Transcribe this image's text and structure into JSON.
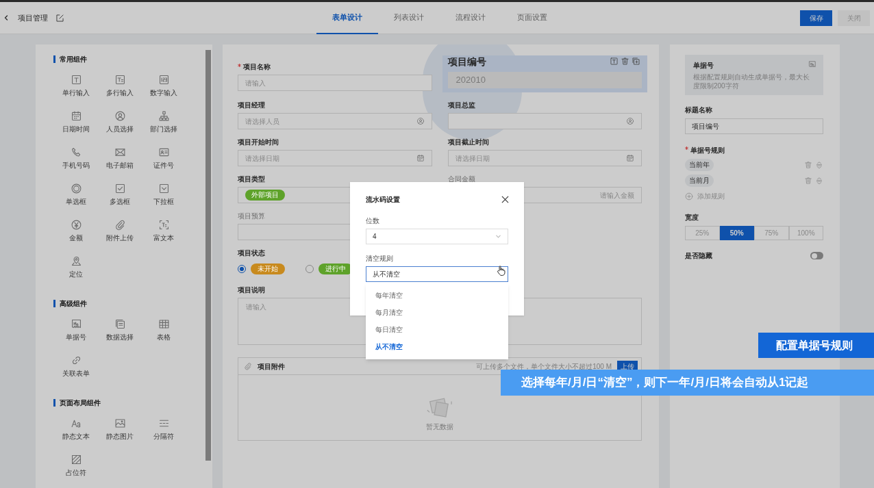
{
  "header": {
    "title": "项目管理",
    "tabs": [
      {
        "label": "表单设计",
        "selected": true
      },
      {
        "label": "列表设计",
        "selected": false
      },
      {
        "label": "流程设计",
        "selected": false
      },
      {
        "label": "页面设置",
        "selected": false
      }
    ],
    "buttons": [
      {
        "label": "保存",
        "kind": "primary"
      },
      {
        "label": "关闭",
        "kind": "disabled"
      }
    ]
  },
  "component_groups": [
    {
      "title": "常用组件",
      "items": [
        "单行输入",
        "多行输入",
        "数字输入",
        "日期时间",
        "人员选择",
        "部门选择",
        "手机号码",
        "电子邮箱",
        "证件号",
        "单选框",
        "多选框",
        "下拉框",
        "金额",
        "附件上传",
        "富文本",
        "定位"
      ]
    },
    {
      "title": "高级组件",
      "items": [
        "单据号",
        "数据选择",
        "表格",
        "关联表单"
      ]
    },
    {
      "title": "页面布局组件",
      "items": [
        "静态文本",
        "静态图片",
        "分隔符",
        "占位符"
      ]
    }
  ],
  "form": {
    "fields": [
      {
        "kind": "text",
        "label": "项目名称",
        "required": true,
        "placeholder": "请输入"
      },
      {
        "kind": "serial",
        "label": "项目编号",
        "value": "202010",
        "selected": true
      },
      {
        "kind": "person",
        "label": "项目经理",
        "placeholder": "请选择人员"
      },
      {
        "kind": "person",
        "label": "项目总监"
      },
      {
        "kind": "date",
        "label": "项目开始时间",
        "placeholder": "请选择日期"
      },
      {
        "kind": "date",
        "label": "项目截止时间",
        "placeholder": "请选择日期"
      },
      {
        "kind": "tags",
        "label": "项目类型",
        "tags": [
          {
            "text": "外部项目",
            "color": "#5ea22a"
          }
        ]
      },
      {
        "kind": "amount",
        "label": "合同金额",
        "disabled": true,
        "placeholder": "请输入金额"
      },
      {
        "kind": "text",
        "label": "项目预算",
        "disabled": true
      },
      {
        "kind": "radio",
        "label": "项目状态",
        "options": [
          {
            "text": "未开始",
            "color": "#c88a1e",
            "selected": true
          },
          {
            "text": "进行中",
            "color": "#5ea22a",
            "selected": false
          }
        ]
      },
      {
        "kind": "textarea",
        "label": "项目说明",
        "placeholder": "请输入"
      },
      {
        "kind": "attachment",
        "label": "项目附件",
        "hint": "可上传多个文件，单个文件大小不超过100 M",
        "button": "上传",
        "empty": "暂无数据"
      }
    ]
  },
  "properties": {
    "card": {
      "title": "单据号",
      "description": "根据配置规则自动生成单据号，最大长度限制200字符"
    },
    "title_label": "标题名称",
    "title_value": "项目编号",
    "rules_label": "单据号规则",
    "rules_required": true,
    "rules": [
      "当前年",
      "当前月"
    ],
    "add_rule": "添加规则",
    "width_label": "宽度",
    "widths": [
      {
        "label": "25%",
        "selected": false
      },
      {
        "label": "50%",
        "selected": true
      },
      {
        "label": "75%",
        "selected": false
      },
      {
        "label": "100%",
        "selected": false
      }
    ],
    "hidden_label": "是否隐藏",
    "hidden_on": false
  },
  "dialog": {
    "title": "流水码设置",
    "fields": [
      {
        "label": "位数",
        "value": "4",
        "focused": false
      },
      {
        "label": "清空规则",
        "value": "从不清空",
        "focused": true
      }
    ],
    "options": [
      {
        "label": "每年清空",
        "selected": false
      },
      {
        "label": "每月清空",
        "selected": false
      },
      {
        "label": "每日清空",
        "selected": false
      },
      {
        "label": "从不清空",
        "selected": true
      }
    ]
  },
  "captions": [
    "配置单据号规则",
    "选择每年/月/日“清空”，则下一年/月/日将会自动从1记起"
  ]
}
